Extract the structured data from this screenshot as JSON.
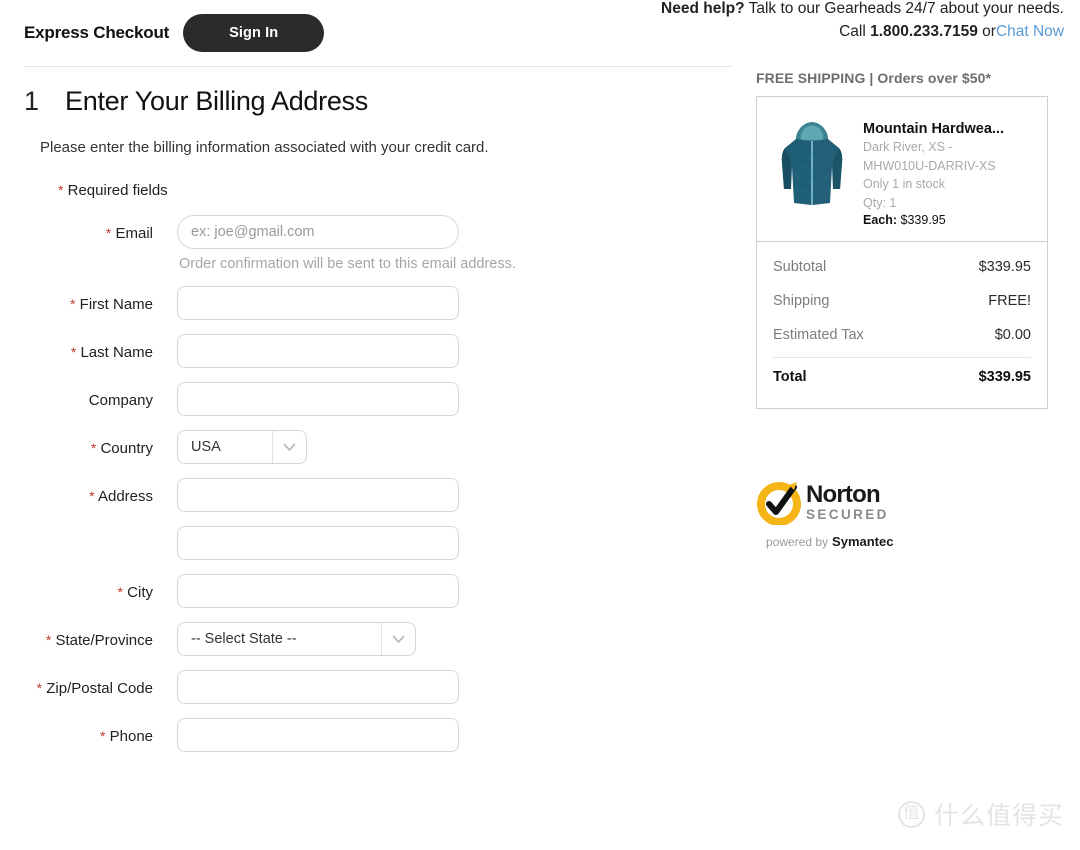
{
  "header": {
    "brand_title": "Express Checkout",
    "signin_label": "Sign In",
    "help_strong": "Need help?",
    "help_text": " Talk to our Gearheads 24/7 about your needs.",
    "call_prefix": "Call ",
    "phone": "1.800.233.7159",
    "call_or": " or",
    "chat_link": "Chat Now"
  },
  "step": {
    "number": "1",
    "title": "Enter Your Billing Address",
    "subtitle": "Please enter the billing information associated with your credit card.",
    "required_note": "Required fields",
    "asterisk": "*"
  },
  "form": {
    "fields": [
      {
        "label": "Email",
        "required": true,
        "type": "text",
        "value": "",
        "placeholder": "ex: joe@gmail.com",
        "hint": "Order confirmation will be sent to this email address."
      },
      {
        "label": "First Name",
        "required": true,
        "type": "text",
        "value": "",
        "placeholder": ""
      },
      {
        "label": "Last Name",
        "required": true,
        "type": "text",
        "value": "",
        "placeholder": ""
      },
      {
        "label": "Company",
        "required": false,
        "type": "text",
        "value": "",
        "placeholder": ""
      },
      {
        "label": "Country",
        "required": true,
        "type": "select",
        "value": "USA"
      },
      {
        "label": "Address",
        "required": true,
        "type": "text",
        "value": "",
        "placeholder": ""
      },
      {
        "label": "",
        "required": false,
        "type": "text",
        "value": "",
        "placeholder": ""
      },
      {
        "label": "City",
        "required": true,
        "type": "text",
        "value": "",
        "placeholder": ""
      },
      {
        "label": "State/Province",
        "required": true,
        "type": "select",
        "value": "-- Select State --"
      },
      {
        "label": "Zip/Postal Code",
        "required": true,
        "type": "text",
        "value": "",
        "placeholder": ""
      },
      {
        "label": "Phone",
        "required": true,
        "type": "text",
        "value": "",
        "placeholder": ""
      }
    ]
  },
  "summary": {
    "shipping_banner": "FREE SHIPPING | Orders over $50*",
    "product": {
      "name": "Mountain Hardwea...",
      "variant": "Dark River, XS -",
      "sku": "MHW010U-DARRIV-XS",
      "stock": "Only  1 in stock",
      "qty": "Qty: 1",
      "each_label": "Each:",
      "each_price": "$339.95",
      "image_alt": "blue insulated hooded jacket"
    },
    "totals": [
      {
        "label": "Subtotal",
        "value": "$339.95"
      },
      {
        "label": "Shipping",
        "value": "FREE!"
      },
      {
        "label": "Estimated Tax",
        "value": "$0.00"
      }
    ],
    "total": {
      "label": "Total",
      "value": "$339.95"
    }
  },
  "trust_badge": {
    "word": "Norton",
    "secured": "SECURED",
    "powered_by": "powered by",
    "brand": "Symantec",
    "tm": "™"
  },
  "watermark": {
    "glyph": "值",
    "text": "什么值得买"
  },
  "colors": {
    "accent_dark": "#2b2b2b",
    "link": "#5b9bd5",
    "required": "#c0392b",
    "muted": "#a9a9a9",
    "border": "#d6d6d6",
    "norton_yellow": "#f5b517"
  }
}
